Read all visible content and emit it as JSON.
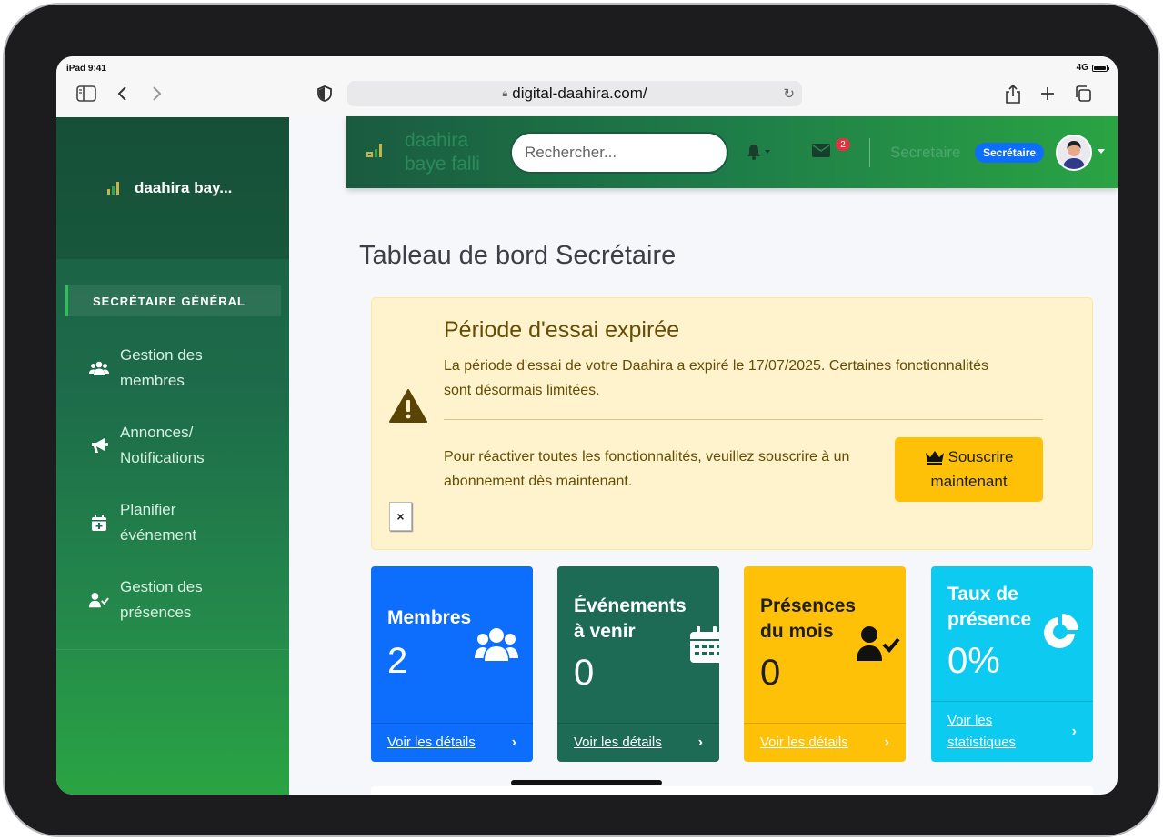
{
  "status_bar": {
    "time": "iPad 9:41",
    "network": "4G"
  },
  "browser": {
    "url": "digital-daahira.com/"
  },
  "sidebar": {
    "brand": "daahira bay...",
    "section": "SECRÉTAIRE GÉNÉRAL",
    "items": [
      {
        "label": "Gestion des membres",
        "icon": "users-icon"
      },
      {
        "label": "Annonces/ Notifications",
        "icon": "megaphone-icon"
      },
      {
        "label": "Planifier événement",
        "icon": "calendar-plus-icon"
      },
      {
        "label": "Gestion des présences",
        "icon": "user-check-icon"
      }
    ]
  },
  "topbar": {
    "brand_line1": "daahira",
    "brand_line2": "baye falli",
    "search_placeholder": "Rechercher...",
    "mail_count": "2",
    "username": "Secretaire",
    "role": "Secrétaire"
  },
  "main": {
    "title": "Tableau de bord Secrétaire",
    "alert": {
      "title": "Période d'essai expirée",
      "text": "La période d'essai de votre Daahira a expiré le 17/07/2025. Certaines fonctionnalités sont désormais limitées.",
      "text2": "Pour réactiver toutes les fonctionnalités, veuillez souscrire à un abonnement dès maintenant.",
      "subscribe_line1": "Souscrire",
      "subscribe_line2": "maintenant",
      "close": "×"
    },
    "cards": [
      {
        "title": "Membres",
        "value": "2",
        "link": "Voir les détails",
        "color": "#0d6efd",
        "icon": "users-icon"
      },
      {
        "title": "Événements à venir",
        "value": "0",
        "link": "Voir les détails",
        "color": "#1e6b55",
        "icon": "calendar-icon"
      },
      {
        "title": "Présences du mois",
        "value": "0",
        "link": "Voir les détails",
        "color": "#ffc107",
        "icon": "user-check-icon"
      },
      {
        "title": "Taux de présence",
        "value": "0%",
        "link": "Voir les statistiques",
        "color": "#0dcaf0",
        "icon": "pie-chart-icon"
      }
    ]
  }
}
